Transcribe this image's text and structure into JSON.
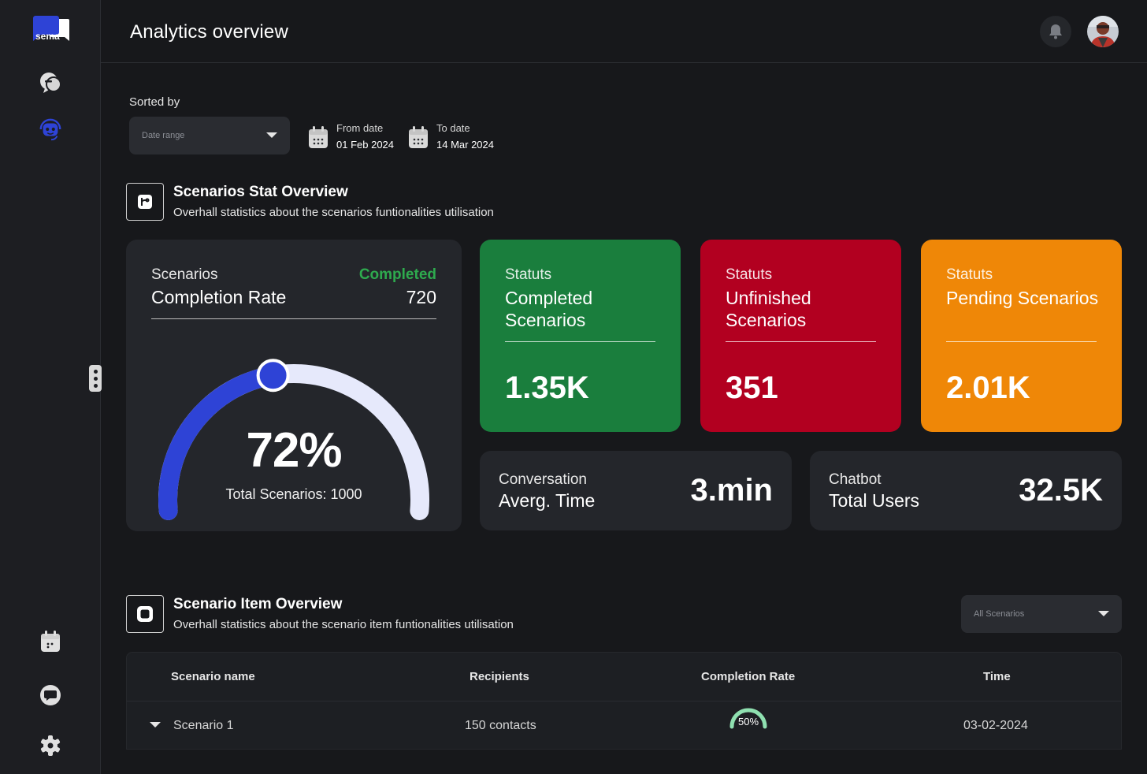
{
  "app": {
    "logo_text": "sema"
  },
  "sidebar": {
    "items": [
      {
        "name": "chat-icon"
      },
      {
        "name": "bot-icon",
        "active": true
      },
      {
        "name": "calendar-icon"
      },
      {
        "name": "message-icon"
      },
      {
        "name": "settings-icon"
      }
    ]
  },
  "header": {
    "title": "Analytics overview"
  },
  "filters": {
    "sorted_label": "Sorted by",
    "date_range_placeholder": "Date range",
    "from_label": "From date",
    "from_value": "01 Feb 2024",
    "to_label": "To date",
    "to_value": "14 Mar 2024"
  },
  "stat_section": {
    "title": "Scenarios Stat Overview",
    "subtitle": "Overhall statistics about the scenarios funtionalities utilisation"
  },
  "completion_card": {
    "label_small": "Scenarios",
    "label_big": "Completion Rate",
    "completed_label": "Completed",
    "completed_value": "720",
    "percent_text": "72%",
    "percent_value": 72,
    "total_text": "Total Scenarios: 1000"
  },
  "status_cards": [
    {
      "small": "Statuts",
      "big": "Completed Scenarios",
      "value": "1.35K",
      "color": "#1a7e3d"
    },
    {
      "small": "Statuts",
      "big": "Unfinished Scenarios",
      "value": "351",
      "color": "#b20020"
    },
    {
      "small": "Statuts",
      "big": "Pending Scenarios",
      "value": "2.01K",
      "color": "#ef8707"
    }
  ],
  "small_cards": [
    {
      "small": "Conversation",
      "big": "Averg. Time",
      "value": "3.min"
    },
    {
      "small": "Chatbot",
      "big": "Total Users",
      "value": "32.5K"
    }
  ],
  "item_section": {
    "title": "Scenario Item Overview",
    "subtitle": "Overhall statistics about the scenario item funtionalities utilisation",
    "filter_placeholder": "All Scenarios"
  },
  "table": {
    "headers": [
      "Scenario name",
      "Recipients",
      "Completion Rate",
      "Time"
    ],
    "rows": [
      {
        "name": "Scenario 1",
        "recipients": "150 contacts",
        "rate": "50%",
        "rate_value": 50,
        "time": "03-02-2024"
      }
    ]
  },
  "colors": {
    "accent": "#2e43d6",
    "gauge_track": "#e6e9fb",
    "completed_green": "#2eaa4e",
    "mini_gauge": "#8fe0b0"
  }
}
